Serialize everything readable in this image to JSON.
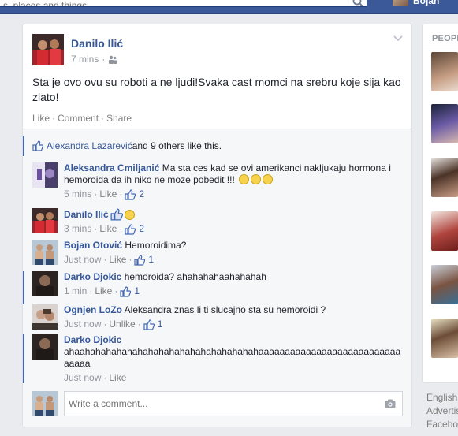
{
  "topbar": {
    "search_placeholder": "s, places and things",
    "user_name": "Bojan"
  },
  "post": {
    "author": "Danilo Ilić",
    "time": "7 mins",
    "privacy_icon": "friends-icon",
    "text": "Sta je ovo ovu su roboti a ne ljudi!Svaka cast momci na srebru koje sija kao zlato!",
    "actions": {
      "like": "Like",
      "comment": "Comment",
      "share": "Share"
    }
  },
  "likes": {
    "first_name": "Alexandra Lazarević",
    "rest": " and 9 others like this."
  },
  "comments": [
    {
      "name": "Aleksandra Cmiljanić",
      "text": "Ma sta ces kad se ovi amerikanci nakljukaju hormona i hemoroida da ih niko ne moze pobedit !!!",
      "emoji_count": 3,
      "time": "5 mins",
      "action": "Like",
      "likes": "2"
    },
    {
      "name": "Danilo Ilić",
      "text": "",
      "emoji_count": 1,
      "time": "3 mins",
      "action": "Like",
      "likes": "2"
    },
    {
      "name": "Bojan Otović",
      "text": "Hemoroidima?",
      "emoji_count": 0,
      "time": "Just now",
      "action": "Like",
      "likes": "1"
    },
    {
      "name": "Darko Djokic",
      "text": "hemoroida? ahahahahaahahahah",
      "emoji_count": 0,
      "time": "1 min",
      "action": "Like",
      "likes": "1"
    },
    {
      "name": "Ognjen LoZo",
      "text": "Aleksandra znas li ti slucajno sta su hemoroidi ?",
      "emoji_count": 0,
      "time": "Just now",
      "action": "Unlike",
      "likes": "1"
    },
    {
      "name": "Darko Djokic",
      "text": "ahaahahahahahahahahahahahahahahahahahaaaaaaaaaaaaaaaaaaaaaaaaaaaaaaaa",
      "emoji_count": 0,
      "time": "Just now",
      "action": "Like",
      "likes": ""
    }
  ],
  "write": {
    "placeholder": "Write a comment..."
  },
  "sidebar": {
    "title": "PEOPLE",
    "footer": [
      "English",
      "Advertis",
      "Facebo"
    ]
  },
  "colors": {
    "brand": "#3b5998",
    "link": "#365899",
    "muted": "#90949c"
  }
}
